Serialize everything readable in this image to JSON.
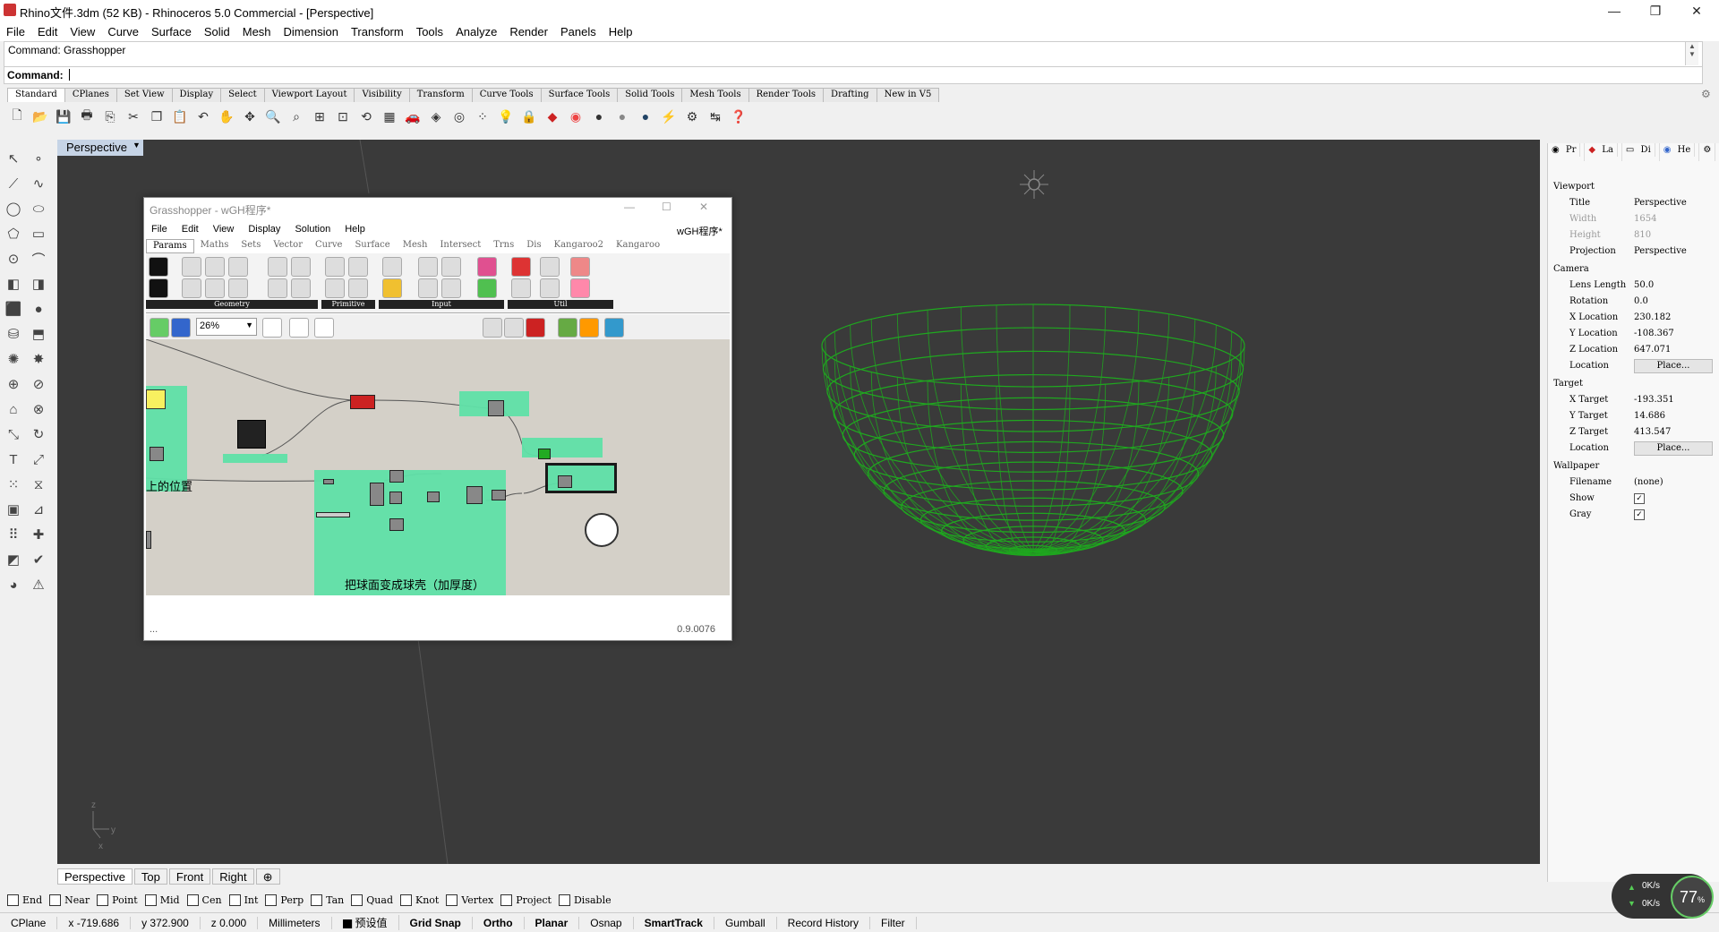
{
  "window": {
    "title": "Rhino文件.3dm (52 KB) - Rhinoceros 5.0 Commercial - [Perspective]"
  },
  "menu": [
    "File",
    "Edit",
    "View",
    "Curve",
    "Surface",
    "Solid",
    "Mesh",
    "Dimension",
    "Transform",
    "Tools",
    "Analyze",
    "Render",
    "Panels",
    "Help"
  ],
  "command": {
    "history": "Command: Grasshopper",
    "prompt": "Command:"
  },
  "toolbar_tabs": [
    "Standard",
    "CPlanes",
    "Set View",
    "Display",
    "Select",
    "Viewport Layout",
    "Visibility",
    "Transform",
    "Curve Tools",
    "Surface Tools",
    "Solid Tools",
    "Mesh Tools",
    "Render Tools",
    "Drafting",
    "New in V5"
  ],
  "viewport": {
    "name": "Perspective",
    "axis_z": "z",
    "axis_y": "y",
    "axis_x": "x"
  },
  "viewport_tabs": [
    "Perspective",
    "Top",
    "Front",
    "Right"
  ],
  "grasshopper": {
    "title": "Grasshopper - wGH程序*",
    "doc_name": "wGH程序*",
    "menu": [
      "File",
      "Edit",
      "View",
      "Display",
      "Solution",
      "Help"
    ],
    "tabs": [
      "Params",
      "Maths",
      "Sets",
      "Vector",
      "Curve",
      "Surface",
      "Mesh",
      "Intersect",
      "Trns",
      "Dis",
      "Kangaroo2",
      "Kangaroo"
    ],
    "ribbon_groups": [
      "Geometry",
      "Primitive",
      "Input",
      "Util"
    ],
    "zoom": "26%",
    "group_label_left": "上的位置",
    "group_label_main": "把球面变成球壳（加厚度）",
    "version": "0.9.0076"
  },
  "properties": {
    "tabs": [
      "Pr",
      "La",
      "Di",
      "He"
    ],
    "sections": {
      "viewport": "Viewport",
      "camera": "Camera",
      "target": "Target",
      "wallpaper": "Wallpaper"
    },
    "viewport_rows": [
      {
        "key": "Title",
        "value": "Perspective"
      },
      {
        "key": "Width",
        "value": "1654"
      },
      {
        "key": "Height",
        "value": "810"
      },
      {
        "key": "Projection",
        "value": "Perspective"
      }
    ],
    "camera_rows": [
      {
        "key": "Lens Length",
        "value": "50.0"
      },
      {
        "key": "Rotation",
        "value": "0.0"
      },
      {
        "key": "X Location",
        "value": "230.182"
      },
      {
        "key": "Y Location",
        "value": "-108.367"
      },
      {
        "key": "Z Location",
        "value": "647.071"
      }
    ],
    "camera_location_label": "Location",
    "place_button": "Place...",
    "target_rows": [
      {
        "key": "X Target",
        "value": "-193.351"
      },
      {
        "key": "Y Target",
        "value": "14.686"
      },
      {
        "key": "Z Target",
        "value": "413.547"
      }
    ],
    "target_location_label": "Location",
    "wallpaper_rows": [
      {
        "key": "Filename",
        "value": "(none)"
      },
      {
        "key": "Show",
        "value": "checked"
      },
      {
        "key": "Gray",
        "value": "checked"
      }
    ]
  },
  "osnaps": [
    "End",
    "Near",
    "Point",
    "Mid",
    "Cen",
    "Int",
    "Perp",
    "Tan",
    "Quad",
    "Knot",
    "Vertex",
    "Project",
    "Disable"
  ],
  "status": {
    "cplane": "CPlane",
    "x": "x -719.686",
    "y": "y 372.900",
    "z": "z 0.000",
    "units": "Millimeters",
    "layer": "预设值",
    "grid_snap": "Grid Snap",
    "ortho": "Ortho",
    "planar": "Planar",
    "osnap": "Osnap",
    "smarttrack": "SmartTrack",
    "gumball": "Gumball",
    "record_history": "Record History",
    "filter": "Filter"
  },
  "net": {
    "up": "0K/s",
    "down": "0K/s",
    "percent": "77"
  },
  "colors": {
    "viewport_bg": "#3a3a3a",
    "mesh_green": "#1fa81f",
    "gh_group": "#5fe0a8"
  }
}
